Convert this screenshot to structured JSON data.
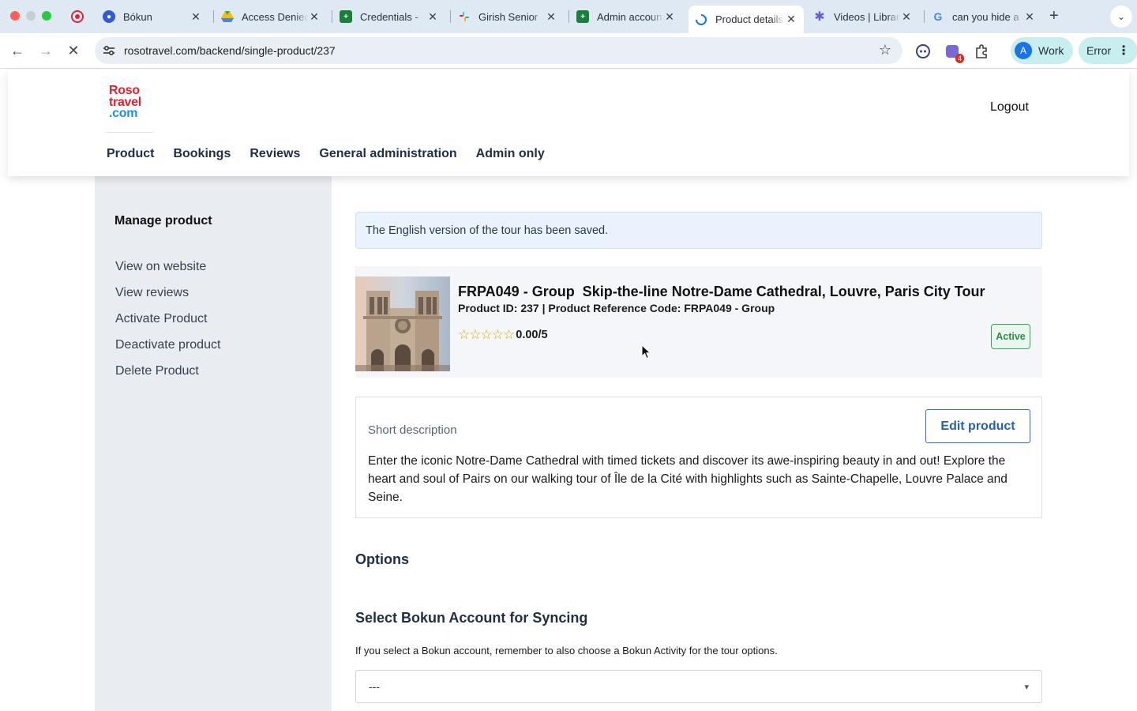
{
  "browser": {
    "tabs": [
      {
        "title": "Bókun",
        "favicon": "bokun-icon",
        "color": "#2f5bd3"
      },
      {
        "title": "Access Denied",
        "favicon": "google-drive-icon",
        "color": "#34a853"
      },
      {
        "title": "Credentials - ",
        "favicon": "sheets-icon",
        "color": "#188038"
      },
      {
        "title": "Girish Senior ",
        "favicon": "slack-icon",
        "color": "#e01e5a"
      },
      {
        "title": "Admin account",
        "favicon": "sheets-icon",
        "color": "#188038"
      },
      {
        "title": "Product details",
        "favicon": "loading-icon",
        "color": "#1a73e8"
      },
      {
        "title": "Videos | Library",
        "favicon": "library-icon",
        "color": "#6b5bd6"
      },
      {
        "title": "can you hide a",
        "favicon": "google-icon",
        "color": "#4285f4"
      }
    ],
    "active_tab": 5,
    "url": "rosotravel.com/backend/single-product/237",
    "extension_badge": "4",
    "profile_initial": "A",
    "profile_label": "Work",
    "error_label": "Error"
  },
  "site": {
    "logo": {
      "line1": "Roso",
      "line2": "travel",
      "line3": ".com"
    },
    "logout": "Logout",
    "nav": [
      "Product",
      "Bookings",
      "Reviews",
      "General administration",
      "Admin only"
    ]
  },
  "sidebar": {
    "title": "Manage product",
    "links": [
      "View on website",
      "View reviews",
      "Activate Product",
      "Deactivate product",
      "Delete Product"
    ]
  },
  "alert": "The English version of the tour has been saved.",
  "product": {
    "title": "FRPA049 - Group  Skip-the-line Notre-Dame Cathedral, Louvre, Paris City Tour",
    "ids": "Product ID: 237 | Product Reference Code: FRPA049 - Group",
    "stars": 5,
    "rating_value": 0,
    "rating_text": "0.00/5",
    "status": "Active",
    "status_color": "#3aa55a"
  },
  "description": {
    "label": "Short description",
    "edit_button": "Edit product",
    "text": "Enter the iconic Notre-Dame Cathedral with timed tickets and discover its awe-inspiring beauty in and out! Explore the heart and soul of Pairs on our walking tour of Île de la Cité with highlights such as Sainte-Chapelle, Louvre Palace and Seine."
  },
  "options": {
    "heading": "Options",
    "bokun_heading": "Select Bokun Account for Syncing",
    "bokun_note": "If you select a Bokun account, remember to also choose a Bokun Activity for the tour options.",
    "bokun_selected": "---"
  }
}
